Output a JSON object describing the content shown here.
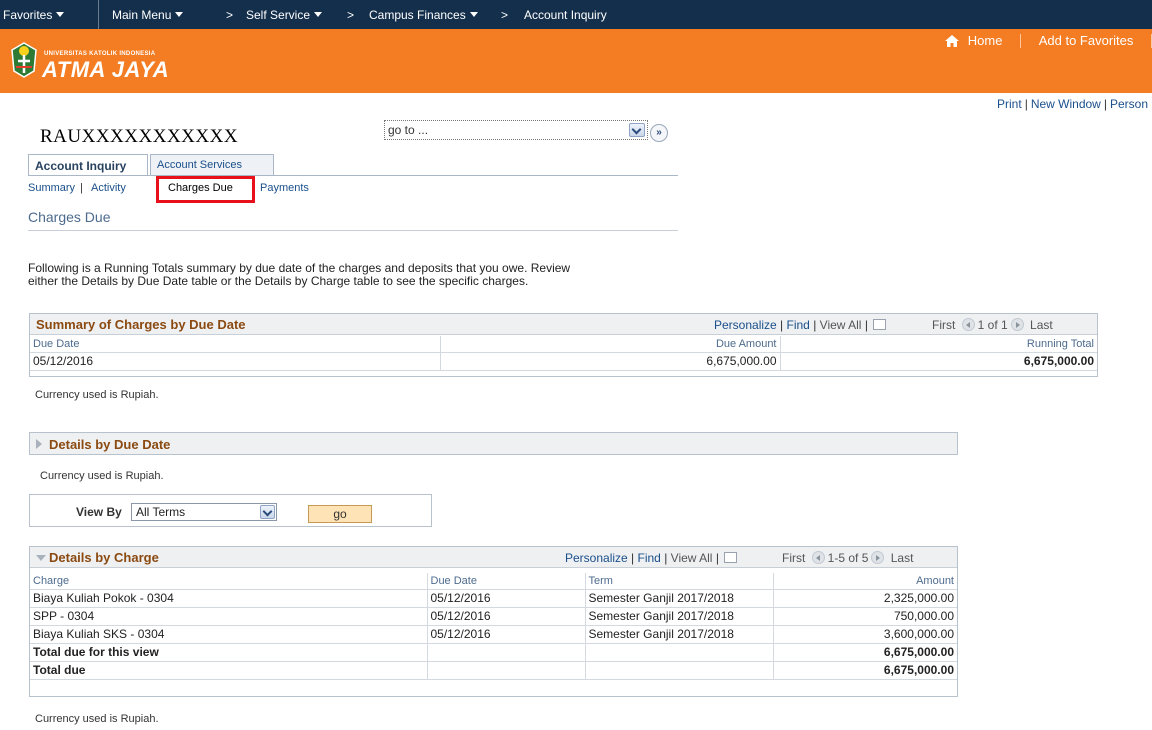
{
  "topnav": {
    "favorites": "Favorites",
    "main_menu": "Main Menu",
    "self_service": "Self Service",
    "campus_finances": "Campus Finances",
    "account_inquiry": "Account Inquiry",
    "separator": ">"
  },
  "header": {
    "logo_small": "UNIVERSITAS KATOLIK INDONESIA",
    "logo_big": "ATMA JAYA",
    "home": "Home",
    "add_to_favorites": "Add to Favorites"
  },
  "print_links": {
    "print": "Print",
    "new_window": "New Window",
    "personalize": "Person",
    "separator": "|"
  },
  "student_id": "RAUXXXXXXXXXXX",
  "goto": {
    "value": "go to ...",
    "button": "»"
  },
  "tabs": {
    "account_inquiry": "Account Inquiry",
    "account_services": "Account Services"
  },
  "subnav": {
    "summary": "Summary",
    "activity": "Activity",
    "charges_due": "Charges Due",
    "payments": "Payments",
    "separator": "|"
  },
  "page_title": "Charges Due",
  "intro": "Following is a Running Totals summary by due date of the charges and deposits that you owe. Review either the Details by Due Date table or the Details by Charge table to see the specific charges.",
  "grid_tools": {
    "personalize": "Personalize",
    "find": "Find",
    "view_all": "View All",
    "first": "First",
    "last": "Last",
    "separator": "|"
  },
  "summary": {
    "title": "Summary of Charges by Due Date",
    "page_info": "1 of 1",
    "columns": [
      "Due Date",
      "Due Amount",
      "Running Total"
    ],
    "rows": [
      {
        "due_date": "05/12/2016",
        "due_amount": "6,675,000.00",
        "running_total": "6,675,000.00"
      }
    ]
  },
  "currency_note": "Currency used is Rupiah.",
  "details_due_date": {
    "title": "Details by Due Date"
  },
  "view_by": {
    "label": "View By",
    "selected": "All Terms",
    "button": "go"
  },
  "details_charge": {
    "title": "Details by Charge",
    "page_info": "1-5 of 5",
    "columns": [
      "Charge",
      "Due Date",
      "Term",
      "Amount"
    ],
    "rows": [
      {
        "charge": "Biaya Kuliah Pokok - 0304",
        "due_date": "05/12/2016",
        "term": "Semester Ganjil 2017/2018",
        "amount": "2,325,000.00"
      },
      {
        "charge": "SPP - 0304",
        "due_date": "05/12/2016",
        "term": "Semester Ganjil 2017/2018",
        "amount": "750,000.00"
      },
      {
        "charge": "Biaya Kuliah SKS - 0304",
        "due_date": "05/12/2016",
        "term": "Semester Ganjil 2017/2018",
        "amount": "3,600,000.00"
      }
    ],
    "total_view_label": "Total due for this view",
    "total_view_amount": "6,675,000.00",
    "total_label": "Total due",
    "total_amount": "6,675,000.00"
  },
  "colors": {
    "nav_bg": "#142f4c",
    "header_bg": "#f47c22",
    "highlight": "#e8101b",
    "grid_title": "#8b4a11",
    "link": "#1a4f8b"
  }
}
